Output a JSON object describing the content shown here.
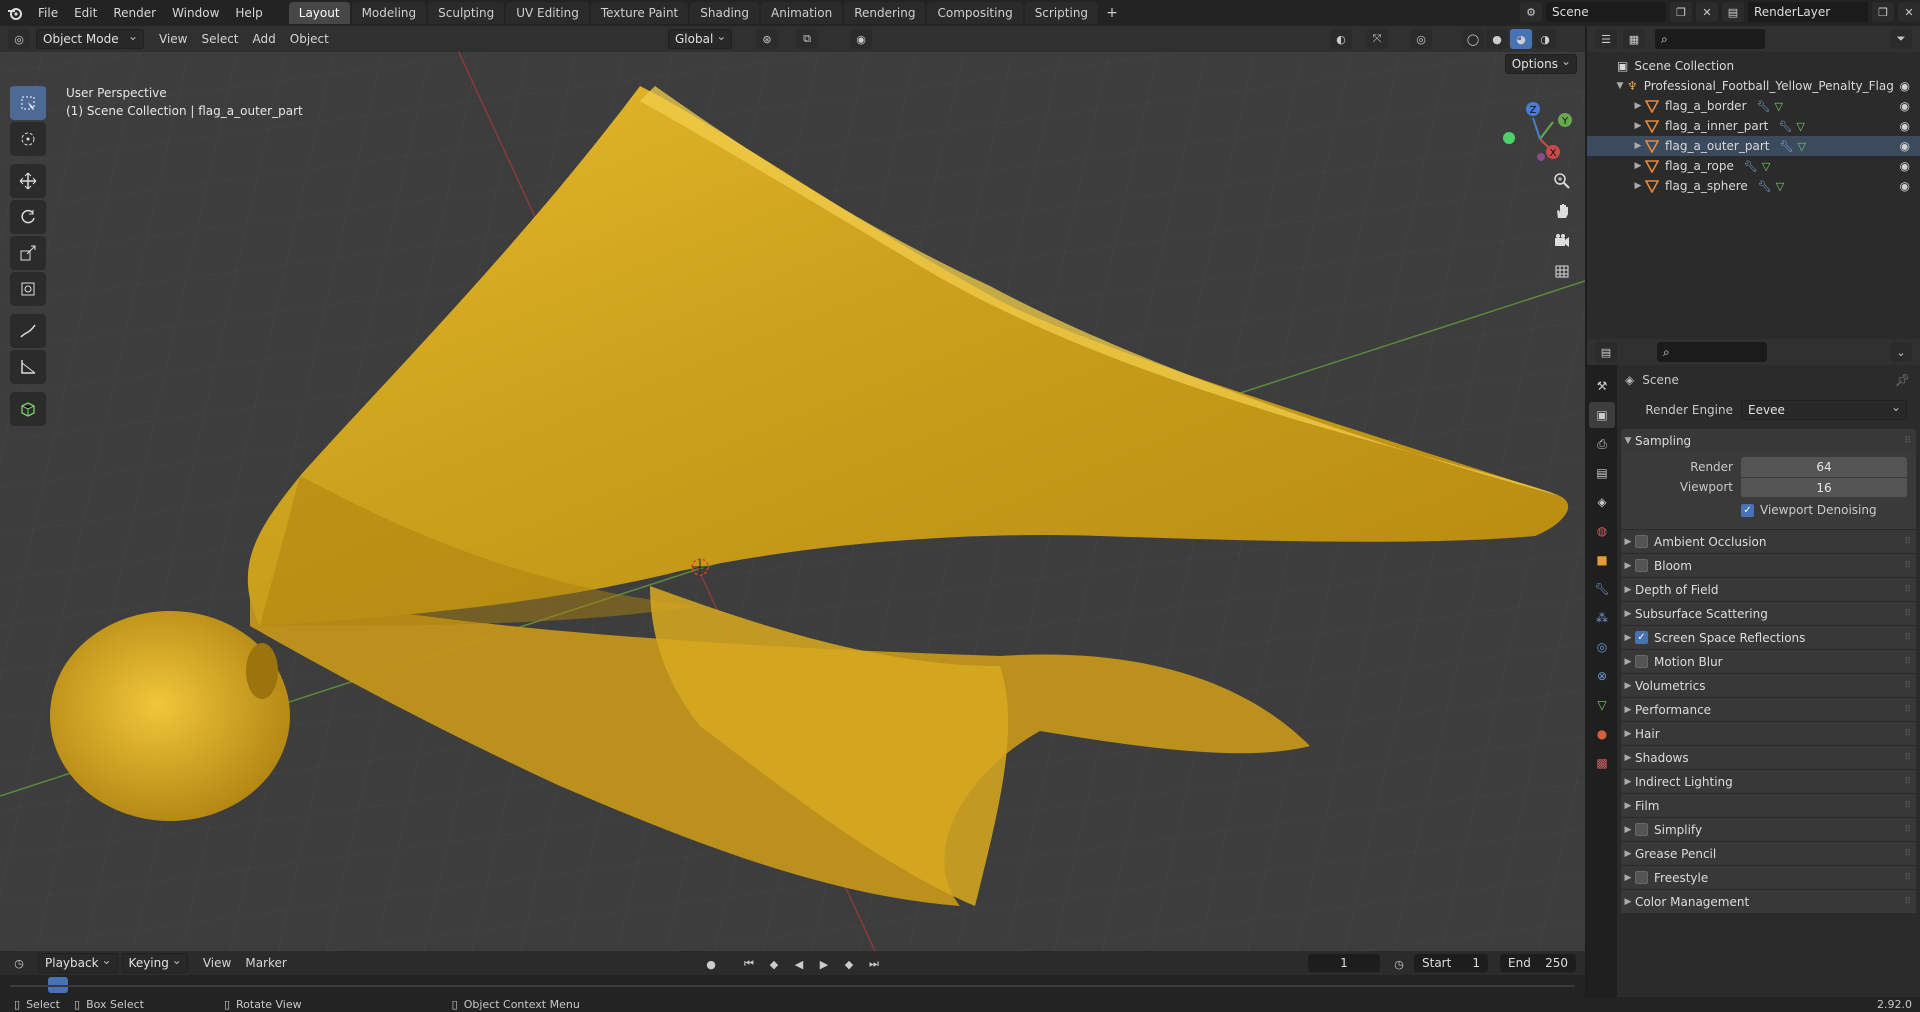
{
  "topbar": {
    "menus": [
      "File",
      "Edit",
      "Render",
      "Window",
      "Help"
    ],
    "workspaces": [
      "Layout",
      "Modeling",
      "Sculpting",
      "UV Editing",
      "Texture Paint",
      "Shading",
      "Animation",
      "Rendering",
      "Compositing",
      "Scripting"
    ],
    "active_workspace": "Layout",
    "add_symbol": "+",
    "scene_name": "Scene",
    "view_layer": "RenderLayer"
  },
  "viewport": {
    "mode": "Object Mode",
    "menus": [
      "View",
      "Select",
      "Add",
      "Object"
    ],
    "transform_orientation": "Global",
    "options_label": "Options",
    "info_line1": "User Perspective",
    "info_line2": "(1) Scene Collection | flag_a_outer_part",
    "gizmo_axes": {
      "x": "X",
      "y": "Y",
      "z": "Z"
    },
    "colors": {
      "background": "#3d3d3d",
      "x_axis": "#b84a4a",
      "y_axis": "#6aa84f",
      "object": "#d4a418"
    }
  },
  "timeline": {
    "menus": [
      "Playback",
      "Keying",
      "View",
      "Marker"
    ],
    "current_frame": "1",
    "start_label": "Start",
    "start_value": "1",
    "end_label": "End",
    "end_value": "250"
  },
  "statusbar": {
    "items": [
      "Select",
      "Box Select",
      "Rotate View",
      "Object Context Menu"
    ],
    "version": "2.92.0"
  },
  "outliner": {
    "root": "Scene Collection",
    "collection": "Professional_Football_Yellow_Penalty_Flag",
    "objects": [
      "flag_a_border",
      "flag_a_inner_part",
      "flag_a_outer_part",
      "flag_a_rope",
      "flag_a_sphere"
    ]
  },
  "properties": {
    "context": "Scene",
    "render_engine_label": "Render Engine",
    "render_engine_value": "Eevee",
    "sampling": {
      "title": "Sampling",
      "render_label": "Render",
      "render_value": "64",
      "viewport_label": "Viewport",
      "viewport_value": "16",
      "denoise_label": "Viewport Denoising",
      "denoise_checked": true
    },
    "panels": [
      {
        "label": "Ambient Occlusion",
        "has_checkbox": true,
        "checked": false
      },
      {
        "label": "Bloom",
        "has_checkbox": true,
        "checked": false
      },
      {
        "label": "Depth of Field",
        "has_checkbox": false,
        "checked": false
      },
      {
        "label": "Subsurface Scattering",
        "has_checkbox": false,
        "checked": false
      },
      {
        "label": "Screen Space Reflections",
        "has_checkbox": true,
        "checked": true
      },
      {
        "label": "Motion Blur",
        "has_checkbox": true,
        "checked": false
      },
      {
        "label": "Volumetrics",
        "has_checkbox": false,
        "checked": false
      },
      {
        "label": "Performance",
        "has_checkbox": false,
        "checked": false
      },
      {
        "label": "Hair",
        "has_checkbox": false,
        "checked": false
      },
      {
        "label": "Shadows",
        "has_checkbox": false,
        "checked": false
      },
      {
        "label": "Indirect Lighting",
        "has_checkbox": false,
        "checked": false
      },
      {
        "label": "Film",
        "has_checkbox": false,
        "checked": false
      },
      {
        "label": "Simplify",
        "has_checkbox": true,
        "checked": false
      },
      {
        "label": "Grease Pencil",
        "has_checkbox": false,
        "checked": false
      },
      {
        "label": "Freestyle",
        "has_checkbox": true,
        "checked": false
      },
      {
        "label": "Color Management",
        "has_checkbox": false,
        "checked": false
      }
    ]
  }
}
